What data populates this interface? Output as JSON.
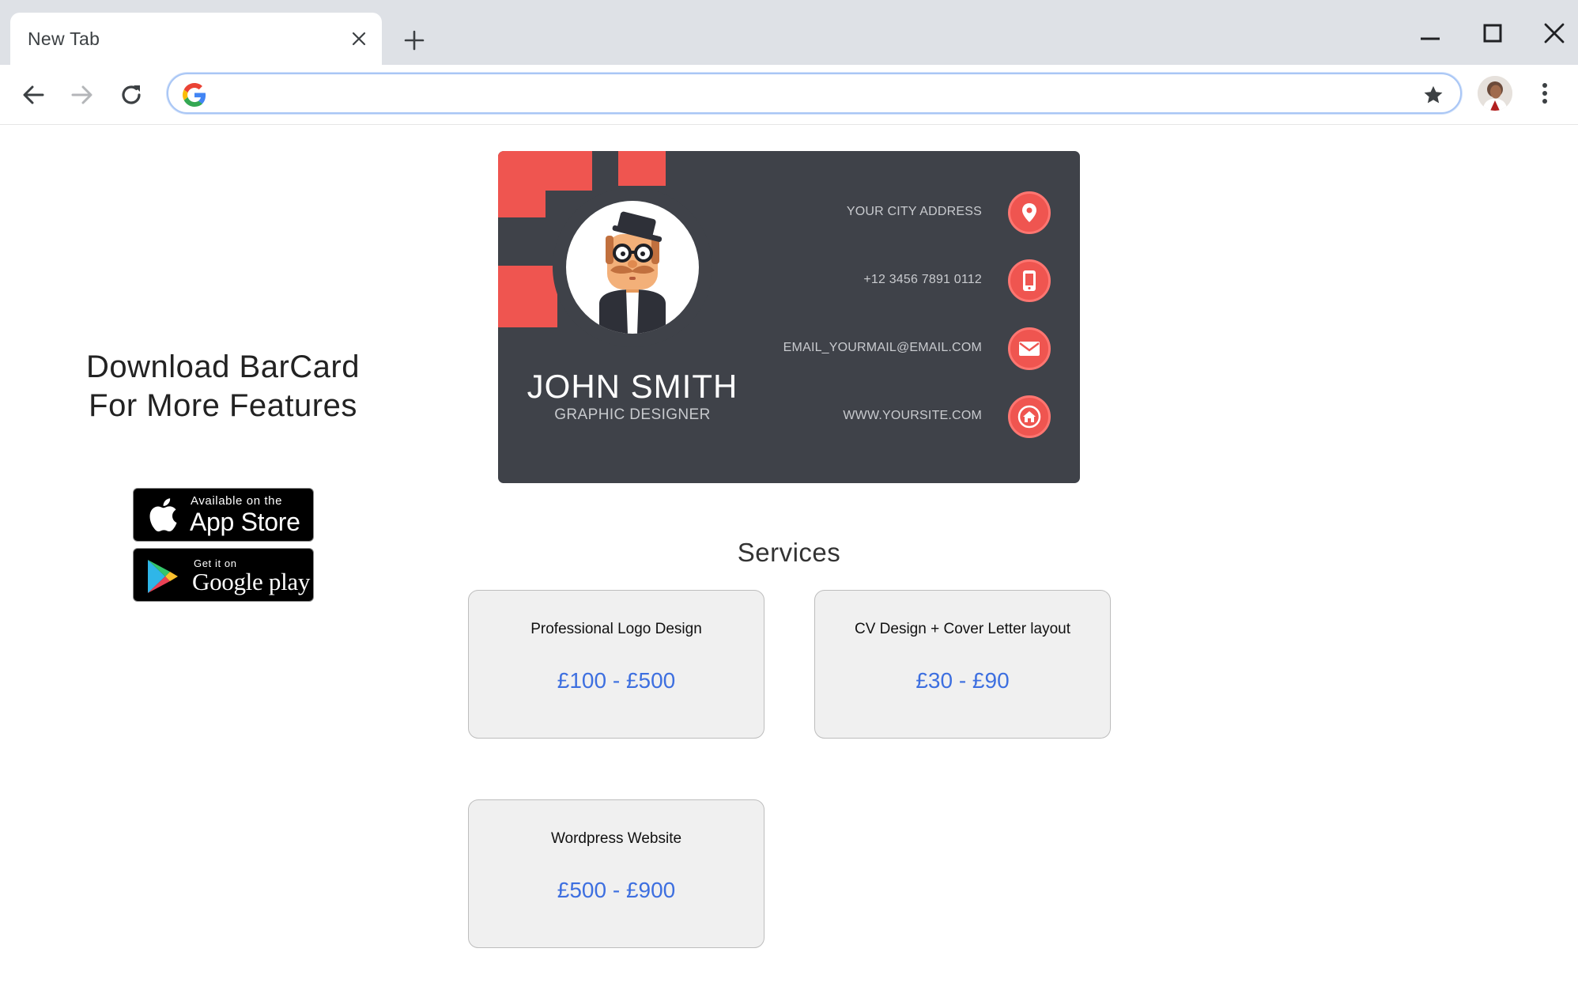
{
  "browser": {
    "tab_title": "New Tab",
    "omnibox_value": "",
    "icons": {
      "tab_close": "close-icon",
      "new_tab": "plus-icon",
      "minimize": "minimize-icon",
      "maximize": "maximize-icon",
      "close_window": "close-window-icon",
      "back": "back-arrow-icon",
      "forward": "forward-arrow-icon",
      "reload": "reload-icon",
      "search_engine": "google-g-icon",
      "bookmark": "star-icon",
      "profile": "profile-avatar",
      "menu": "more-vert-icon"
    }
  },
  "promo": {
    "line1": "Download BarCard",
    "line2": "For More Features"
  },
  "badges": {
    "app_store": {
      "small": "Available on the",
      "big": "App Store",
      "icon": "apple-icon"
    },
    "google_play": {
      "small": "Get it on",
      "big": "Google play",
      "icon": "google-play-icon"
    }
  },
  "business_card": {
    "name": "JOHN SMITH",
    "title": "GRAPHIC DESIGNER",
    "contacts": [
      {
        "text": "YOUR CITY ADDRESS",
        "icon": "map-pin-icon"
      },
      {
        "text": "+12 3456 7891 0112",
        "icon": "phone-icon"
      },
      {
        "text": "EMAIL_YOURMAIL@EMAIL.COM",
        "icon": "envelope-icon"
      },
      {
        "text": "WWW.YOURSITE.COM",
        "icon": "home-icon"
      }
    ],
    "colors": {
      "background": "#3f4249",
      "accent": "#ef5550"
    }
  },
  "services": {
    "heading": "Services",
    "items": [
      {
        "name": "Professional Logo Design",
        "price": "£100 - £500"
      },
      {
        "name": "CV Design + Cover Letter layout",
        "price": "£30 - £90"
      },
      {
        "name": "Wordpress Website",
        "price": "£500 - £900"
      }
    ],
    "colors": {
      "price": "#3d6fe0",
      "card_background": "#f0f0f0"
    }
  }
}
